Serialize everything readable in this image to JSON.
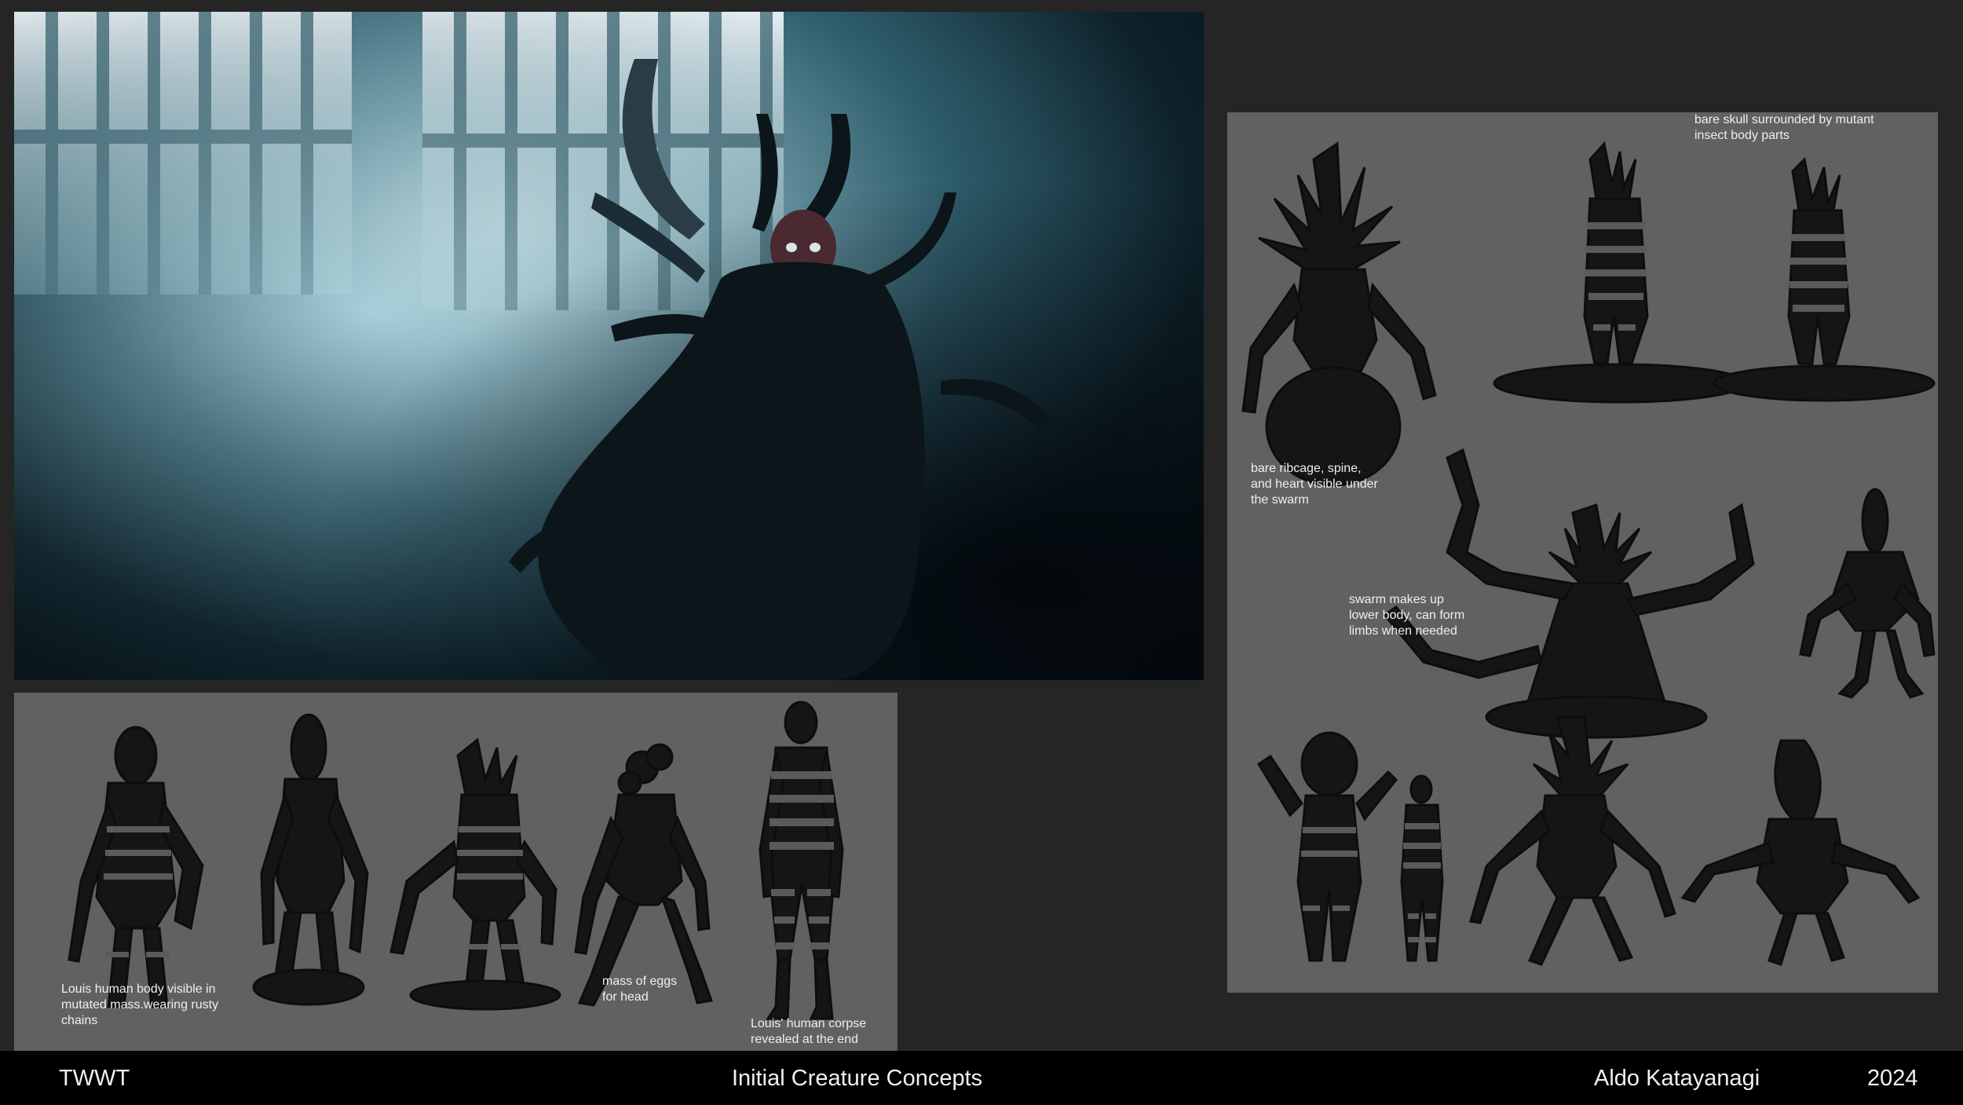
{
  "footer": {
    "project": "TWWT",
    "title": "Initial Creature Concepts",
    "artist": "Aldo Katayanagi",
    "year": "2024"
  },
  "bottom_sheet": {
    "notes": {
      "body": "Louis human body visible in\nmutated mass.wearing rusty\nchains",
      "eggs": "mass of eggs\nfor head",
      "corpse": "Louis' human corpse\nrevealed at the end"
    }
  },
  "right_sheet": {
    "notes": {
      "skull": "bare skull surrounded by mutant\ninsect body parts",
      "ribcage": "bare ribcage, spine,\nand heart visible under\nthe swarm",
      "swarm": "swarm makes up\nlower body, can form\nlimbs when needed"
    }
  },
  "colors": {
    "background": "#252525",
    "sheet": "#616161",
    "footer": "#000000",
    "footer_text": "#f0f0f0",
    "hero_light": "#d6eef4",
    "hero_dark": "#050b0f"
  }
}
